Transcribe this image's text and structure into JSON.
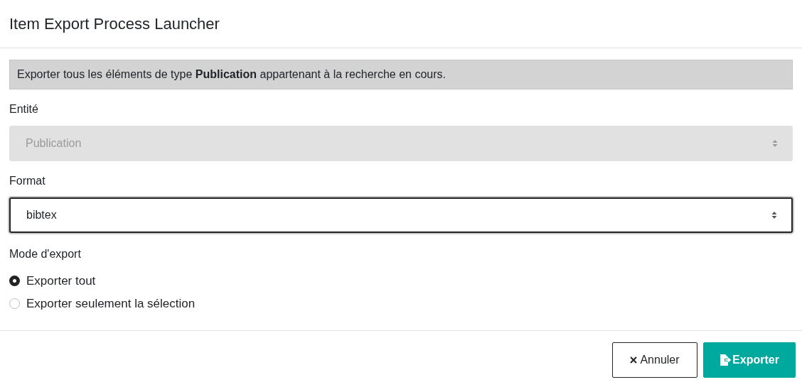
{
  "dialog": {
    "title": "Item Export Process Launcher"
  },
  "info": "Exporter tous les éléments de type **Publication** appartenant à la recherche en cours.",
  "fields": [
    {
      "label": "Entité",
      "value": "Publication",
      "disabled": true,
      "focused": false
    },
    {
      "label": "Format",
      "value": "bibtex",
      "disabled": false,
      "focused": true
    }
  ],
  "export_mode": {
    "label": "Mode d'export",
    "options": [
      {
        "label": "Exporter tout",
        "selected": true
      },
      {
        "label": "Exporter seulement la sélection",
        "selected": false
      }
    ]
  },
  "buttons": [
    {
      "kind": "cancel",
      "label": "Annuler"
    },
    {
      "kind": "export",
      "label": "Exporter"
    }
  ]
}
